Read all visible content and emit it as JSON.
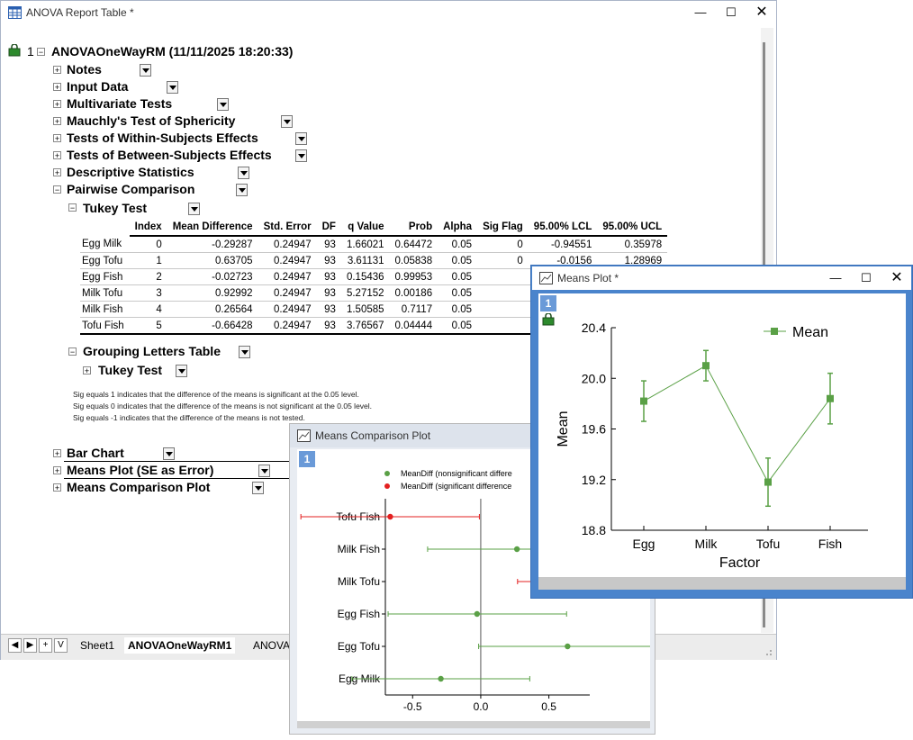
{
  "report": {
    "title": "ANOVA Report Table *",
    "root_index": "1",
    "root_label": "ANOVAOneWayRM (11/11/2025 18:20:33)",
    "nodes": [
      "Notes",
      "Input Data",
      "Multivariate Tests",
      "Mauchly's Test of Sphericity",
      "Tests of Within-Subjects Effects",
      "Tests of Between-Subjects Effects",
      "Descriptive Statistics",
      "Pairwise Comparison"
    ],
    "tukey_label": "Tukey Test",
    "tukey_table": {
      "headers": [
        "",
        "Index",
        "Mean Difference",
        "Std. Error",
        "DF",
        "q Value",
        "Prob",
        "Alpha",
        "Sig Flag",
        "95.00% LCL",
        "95.00% UCL"
      ],
      "rows": [
        [
          "Egg Milk",
          "0",
          "-0.29287",
          "0.24947",
          "93",
          "1.66021",
          "0.64472",
          "0.05",
          "0",
          "-0.94551",
          "0.35978"
        ],
        [
          "Egg Tofu",
          "1",
          "0.63705",
          "0.24947",
          "93",
          "3.61131",
          "0.05838",
          "0.05",
          "0",
          "-0.0156",
          "1.28969"
        ],
        [
          "Egg Fish",
          "2",
          "-0.02723",
          "0.24947",
          "93",
          "0.15436",
          "0.99953",
          "0.05",
          "",
          "",
          ""
        ],
        [
          "Milk Tofu",
          "3",
          "0.92992",
          "0.24947",
          "93",
          "5.27152",
          "0.00186",
          "0.05",
          "",
          "",
          ""
        ],
        [
          "Milk Fish",
          "4",
          "0.26564",
          "0.24947",
          "93",
          "1.50585",
          "0.7117",
          "0.05",
          "",
          "",
          ""
        ],
        [
          "Tofu Fish",
          "5",
          "-0.66428",
          "0.24947",
          "93",
          "3.76567",
          "0.04444",
          "0.05",
          "",
          "",
          ""
        ]
      ]
    },
    "grouping_label": "Grouping Letters Table",
    "grouping_tukey_label": "Tukey Test",
    "notes": [
      "Sig equals 1 indicates that the difference of the means is significant at the 0.05 level.",
      "Sig equals 0 indicates that the difference of the means is not significant at the 0.05 level.",
      "Sig equals -1 indicates that the difference of the means is not tested."
    ],
    "bottom_nodes": [
      "Bar Chart",
      "Means Plot (SE as Error)",
      "Means Comparison Plot"
    ],
    "tabs": [
      "Sheet1",
      "ANOVAOneWayRM1",
      "ANOVA"
    ],
    "nav_buttons": [
      "◀",
      "▶",
      "+",
      "V"
    ]
  },
  "means_comparison": {
    "title": "Means Comparison Plot",
    "page": "1",
    "chart_data": {
      "type": "scatter",
      "categories": [
        "Tofu Fish",
        "Milk Fish",
        "Milk Tofu",
        "Egg Fish",
        "Egg Tofu",
        "Egg Milk"
      ],
      "values": [
        -0.66428,
        0.26564,
        0.92992,
        -0.02723,
        0.63705,
        -0.29287
      ],
      "lcl": [
        -1.32,
        -0.39,
        0.27,
        -0.68,
        -0.0156,
        -0.94551
      ],
      "ucl": [
        -0.01,
        0.92,
        1.58,
        0.63,
        1.28969,
        0.35978
      ],
      "significant": [
        true,
        false,
        true,
        false,
        false,
        false
      ],
      "xlim": [
        -0.7,
        0.8
      ],
      "xticks": [
        "-0.5",
        "0.0",
        "0.5"
      ],
      "legend": [
        "MeanDiff (nonsignificant differe",
        "MeanDiff (significant difference"
      ],
      "colors": {
        "nonsig": "#5aa046",
        "sig": "#e32020"
      }
    }
  },
  "means_plot": {
    "title": "Means Plot *",
    "page": "1",
    "chart_data": {
      "type": "line",
      "categories": [
        "Egg",
        "Milk",
        "Tofu",
        "Fish"
      ],
      "values": [
        19.82,
        20.1,
        19.18,
        19.84
      ],
      "errors": [
        0.16,
        0.12,
        0.19,
        0.2
      ],
      "ylim": [
        18.8,
        20.4
      ],
      "yticks": [
        "18.8",
        "19.2",
        "19.6",
        "20.0",
        "20.4"
      ],
      "xlabel": "Factor",
      "ylabel": "Mean",
      "legend": "Mean",
      "color": "#5aa046"
    }
  }
}
